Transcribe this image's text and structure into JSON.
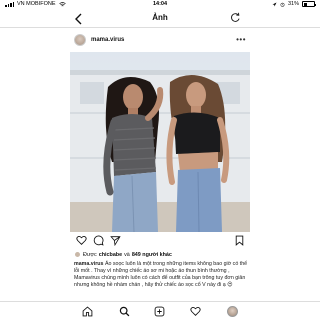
{
  "status_bar": {
    "carrier": "VN MOBIFONE",
    "time": "14:04",
    "battery": "31%"
  },
  "nav": {
    "title": "Ảnh"
  },
  "post": {
    "username": "mama.virus",
    "likes": {
      "liked_by_prefix": "Được",
      "liked_by_user": "chicbabe",
      "connector": "và",
      "others": "849 người khác"
    },
    "caption": {
      "username": "mama.virus",
      "text": "Áo soọc luôn là một trong những items không bao giờ có thể lỗi mốt . Thay vì những chiếc áo sơ mi hoặc áo thun bình thường , Mamavirus chúng mình luôn có cách để outfit của bạn trông tuy đơn giản nhưng không hề nhàm chán , hãy thử chiếc áo sọc cổ V này đi ạ 😍"
    }
  }
}
